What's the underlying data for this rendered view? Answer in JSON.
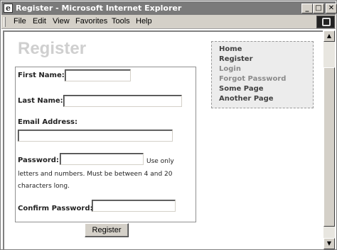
{
  "window": {
    "title": "Register - Microsoft Internet Explorer",
    "minimize_glyph": "_",
    "maximize_glyph": "□",
    "close_glyph": "✕"
  },
  "menu": {
    "items": [
      "File",
      "Edit",
      "View",
      "Favorites",
      "Tools",
      "Help"
    ]
  },
  "scrollbar": {
    "up_glyph": "▲",
    "down_glyph": "▼"
  },
  "page": {
    "title": "Register"
  },
  "nav": {
    "links": [
      "Home",
      "Register",
      "Login",
      "Forgot Password",
      "Some Page",
      "Another Page"
    ]
  },
  "form": {
    "first_name_label": "First Name:",
    "first_name_value": "",
    "last_name_label": "Last Name:",
    "last_name_value": "",
    "email_label": "Email Address:",
    "email_value": "",
    "password_label": "Password:",
    "password_value": "",
    "password_hint_line1": "Use only",
    "password_hint_line2": "letters and numbers. Must be between 4 and 20",
    "password_hint_line3": "characters long.",
    "confirm_label": "Confirm Password:",
    "confirm_value": "",
    "submit_label": "Register"
  }
}
